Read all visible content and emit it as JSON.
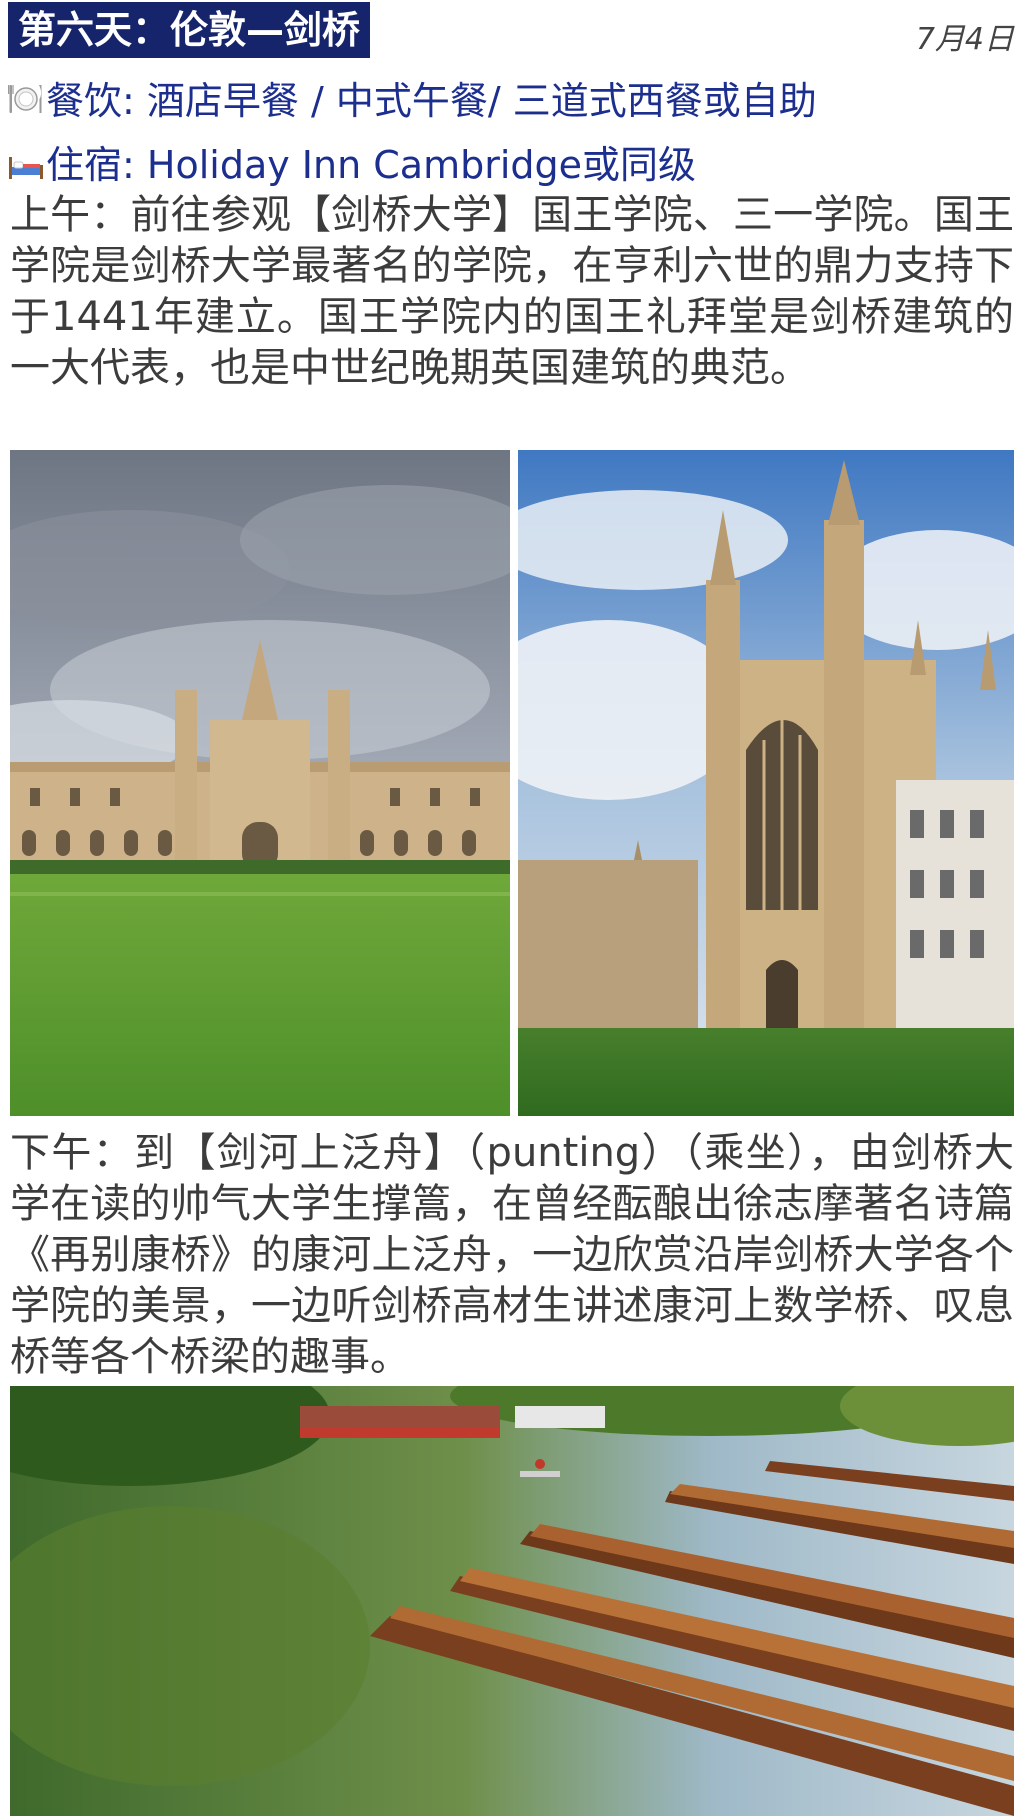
{
  "header": {
    "title": "第六天：伦敦—剑桥",
    "date": "7月4日"
  },
  "meals": {
    "icon": "plate-fork-knife-icon",
    "text": "餐饮: 酒店早餐 / 中式午餐/  三道式西餐或自助"
  },
  "lodging": {
    "icon": "bed-icon",
    "text": "住宿: Holiday Inn Cambridge或同级"
  },
  "morning": {
    "text": "上午：前往参观【剑桥大学】国王学院、三一学院。国王学院是剑桥大学最著名的学院，在亨利六世的鼎力支持下于1441年建立。国王学院内的国王礼拜堂是剑桥建筑的一大代表，也是中世纪晚期英国建筑的典范。"
  },
  "afternoon": {
    "text": "下午：到【剑河上泛舟】（punting）（乘坐），由剑桥大学在读的帅气大学生撑篙，在曾经酝酿出徐志摩著名诗篇《再别康桥》的康河上泛舟，一边欣赏沿岸剑桥大学各个学院的美景，一边听剑桥高材生讲述康河上数学桥、叹息桥等各个桥梁的趣事。"
  },
  "colors": {
    "title_bg": "#16246b",
    "accent_blue": "#1c2f8e",
    "body_text": "#3c3c3c"
  }
}
